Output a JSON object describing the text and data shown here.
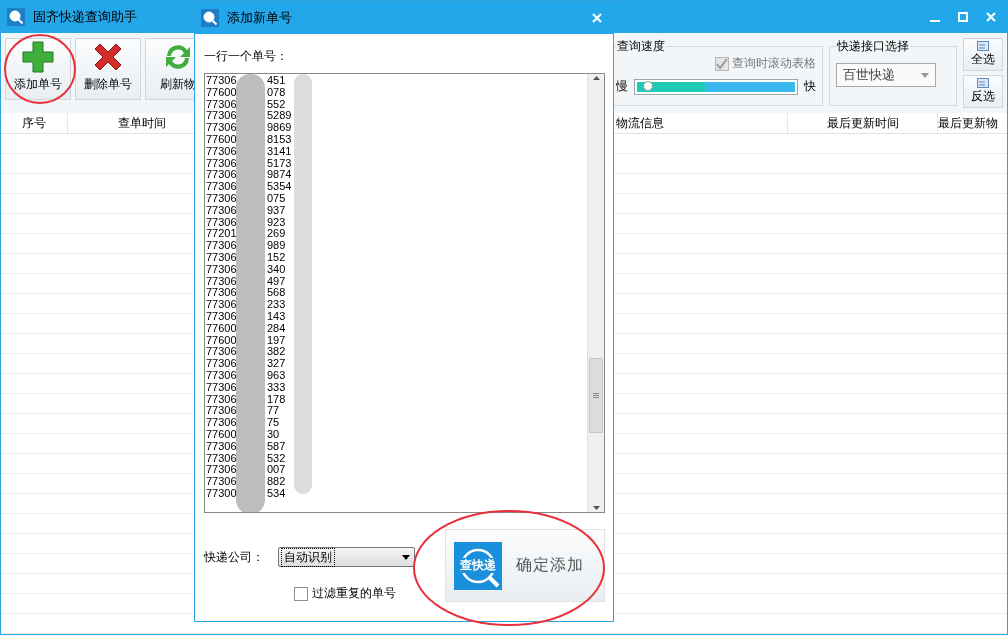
{
  "main_window": {
    "title": "固齐快递查询助手"
  },
  "toolbar": {
    "buttons": [
      {
        "label": "添加单号",
        "kind": "add"
      },
      {
        "label": "删除单号",
        "kind": "delete"
      },
      {
        "label": "刷新物",
        "kind": "refresh"
      }
    ],
    "speed": {
      "legend": "查询速度",
      "scroll_checkbox": {
        "label": "查询时滚动表格",
        "checked": true,
        "disabled": true
      },
      "slow": "慢",
      "fast": "快",
      "level": 0.43
    },
    "api": {
      "legend": "快递接口选择",
      "value": "百世快递"
    },
    "select_all": "全选",
    "invert": "反选"
  },
  "table": {
    "columns": [
      {
        "label": "序号"
      },
      {
        "label": "查单时间"
      },
      {
        "label": "物流信息"
      },
      {
        "label": "最后更新时间"
      },
      {
        "label": "最后更新物"
      }
    ]
  },
  "dialog": {
    "title": "添加新单号",
    "prompt": "一行一个单号：",
    "lines": [
      {
        "start": "77306",
        "end": "451"
      },
      {
        "start": "77600",
        "end": "078"
      },
      {
        "start": "77306",
        "end": "552"
      },
      {
        "start": "77306",
        "end": "5289"
      },
      {
        "start": "77306",
        "end": "9869"
      },
      {
        "start": "77600",
        "end": "8153"
      },
      {
        "start": "77306",
        "end": "3141"
      },
      {
        "start": "77306",
        "end": "5173"
      },
      {
        "start": "77306",
        "end": "9874"
      },
      {
        "start": "77306",
        "end": "5354"
      },
      {
        "start": "77306",
        "end": "075"
      },
      {
        "start": "77306",
        "end": "937"
      },
      {
        "start": "77306",
        "end": "923"
      },
      {
        "start": "77201",
        "end": "269"
      },
      {
        "start": "77306",
        "end": "989"
      },
      {
        "start": "77306",
        "end": "152"
      },
      {
        "start": "77306",
        "end": "340"
      },
      {
        "start": "77306",
        "end": "497"
      },
      {
        "start": "77306",
        "end": "568"
      },
      {
        "start": "77306",
        "end": "233"
      },
      {
        "start": "77306",
        "end": "143"
      },
      {
        "start": "77600",
        "end": "284"
      },
      {
        "start": "77600",
        "end": "197"
      },
      {
        "start": "77306",
        "end": "382"
      },
      {
        "start": "77306",
        "end": "327"
      },
      {
        "start": "77306",
        "end": "963"
      },
      {
        "start": "77306",
        "end": "333"
      },
      {
        "start": "77306",
        "end": "178"
      },
      {
        "start": "77306",
        "end": "77"
      },
      {
        "start": "77306",
        "end": "75"
      },
      {
        "start": "77600",
        "end": "30"
      },
      {
        "start": "77306",
        "end": "587"
      },
      {
        "start": "77306",
        "end": "532"
      },
      {
        "start": "77306",
        "end": "007"
      },
      {
        "start": "77306",
        "end": "882"
      },
      {
        "start": "77300",
        "end": "534"
      }
    ],
    "company_label": "快递公司：",
    "company_value": "自动识别",
    "filter_checkbox": {
      "label": "过滤重复的单号",
      "checked": false
    },
    "confirm": {
      "icon_text": "查快递",
      "label": "确定添加"
    }
  }
}
